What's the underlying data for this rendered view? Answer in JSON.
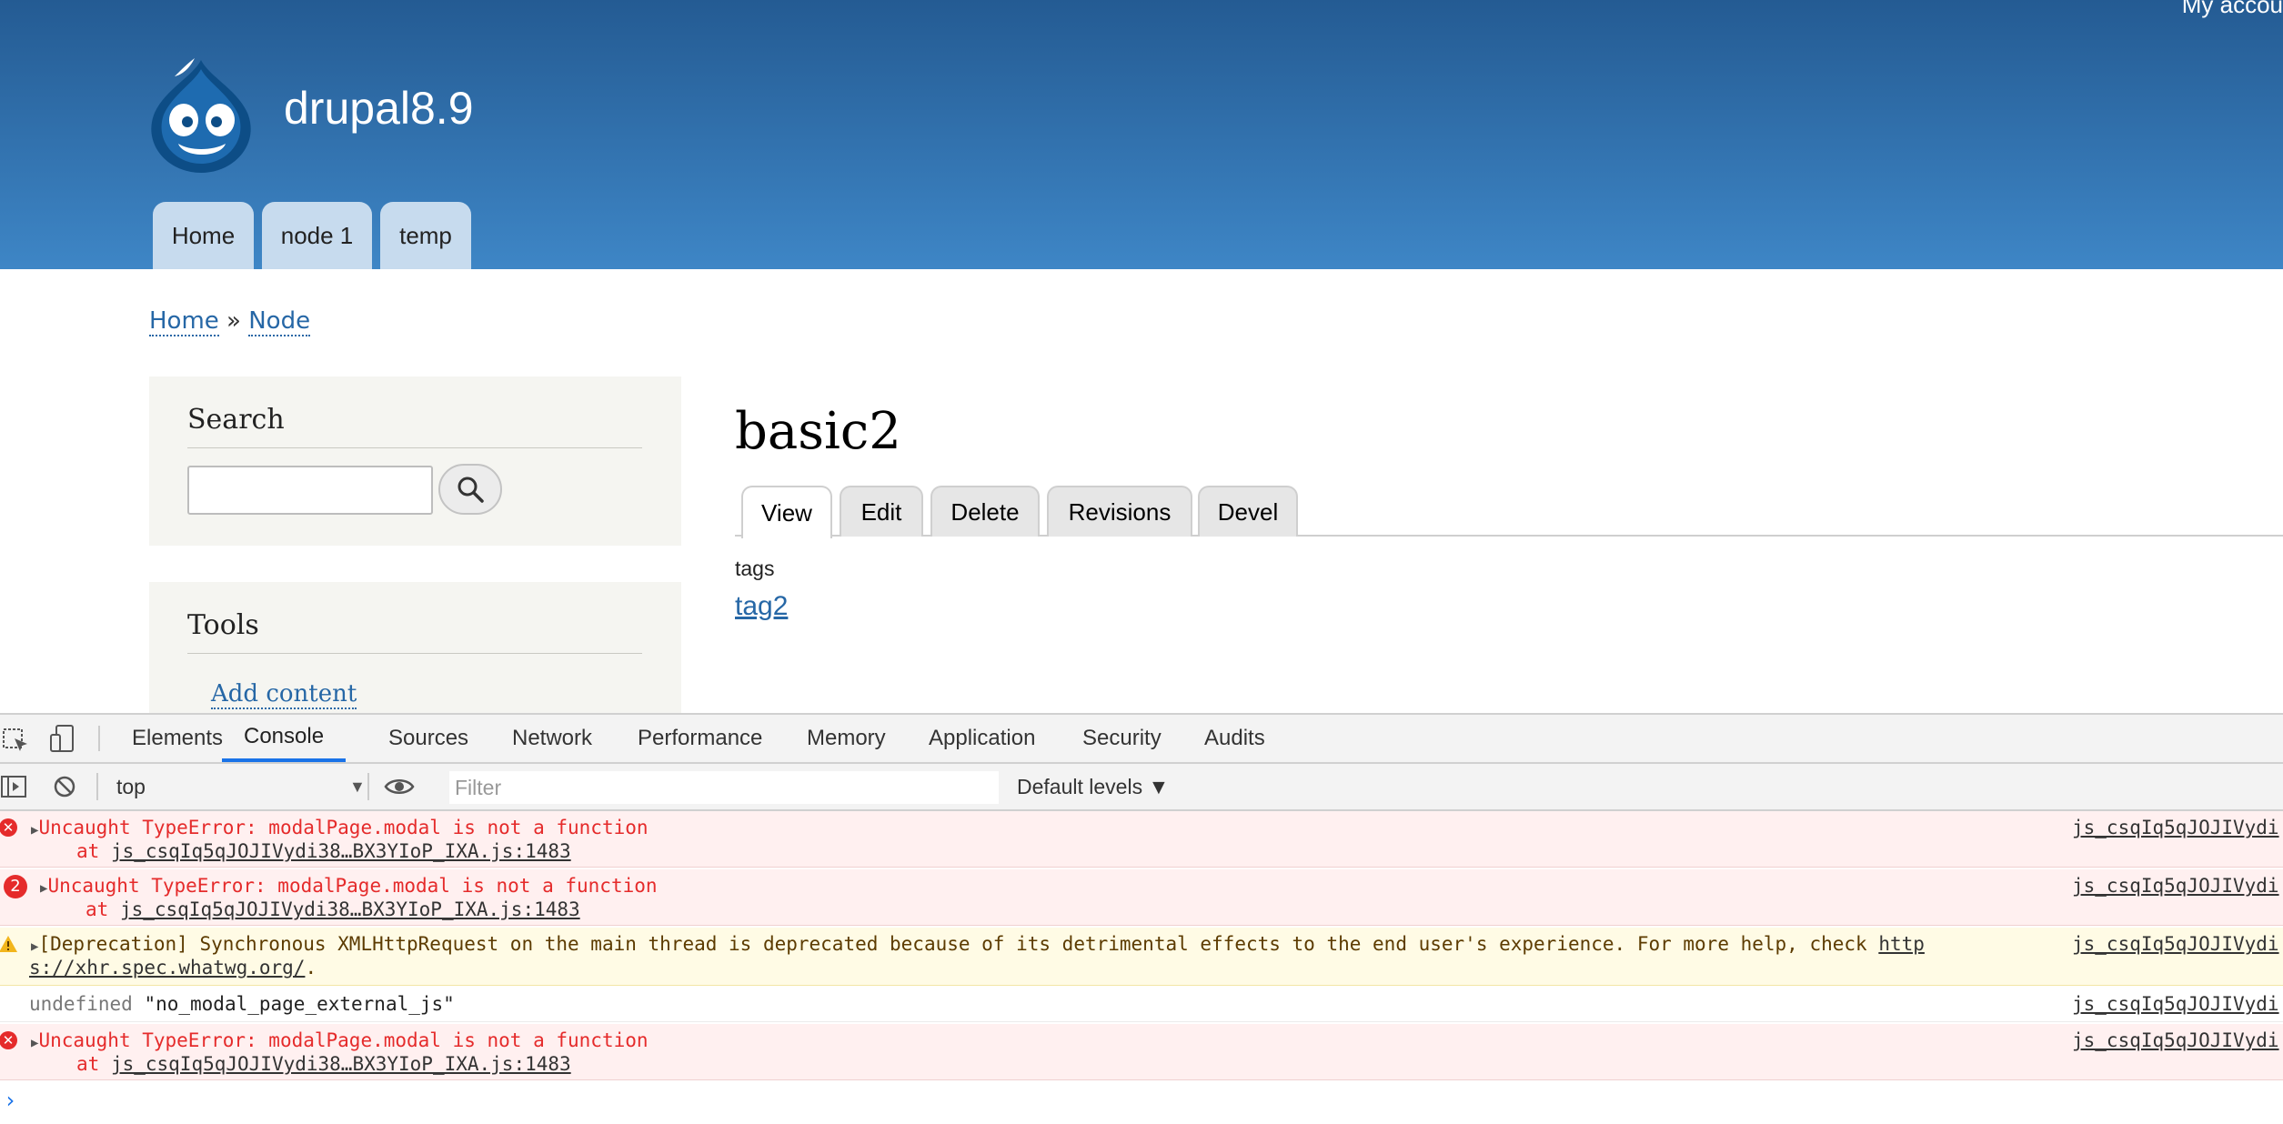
{
  "header": {
    "account_link": "My accou",
    "site_name": "drupal8.9",
    "nav": [
      "Home",
      "node 1",
      "temp"
    ]
  },
  "breadcrumb": {
    "home": "Home",
    "separator": "»",
    "node": "Node"
  },
  "sidebar": {
    "search_title": "Search",
    "search_placeholder": "",
    "tools_title": "Tools",
    "add_content": "Add content"
  },
  "main": {
    "title": "basic2",
    "tabs": [
      "View",
      "Edit",
      "Delete",
      "Revisions",
      "Devel"
    ],
    "active_tab": "View",
    "field_label": "tags",
    "tag": "tag2"
  },
  "devtools": {
    "tabs": [
      "Elements",
      "Console",
      "Sources",
      "Network",
      "Performance",
      "Memory",
      "Application",
      "Security",
      "Audits"
    ],
    "active_tab": "Console",
    "context": "top",
    "filter_placeholder": "Filter",
    "levels": "Default levels ▼",
    "messages": [
      {
        "level": "error",
        "count": "",
        "text": "Uncaught TypeError: modalPage.modal is not a function",
        "at_prefix": "at ",
        "at_link": "js_csqIq5qJOJIVydi38…BX3YIoP_IXA.js:1483",
        "source": "js_csqIq5qJOJIVydi"
      },
      {
        "level": "error",
        "count": "2",
        "text": "Uncaught TypeError: modalPage.modal is not a function",
        "at_prefix": "at ",
        "at_link": "js_csqIq5qJOJIVydi38…BX3YIoP_IXA.js:1483",
        "source": "js_csqIq5qJOJIVydi"
      },
      {
        "level": "warning",
        "text": "[Deprecation] Synchronous XMLHttpRequest on the main thread is deprecated because of its detrimental effects to the end user's experience. For more help, check ",
        "link_a": "http",
        "link_b": "s://xhr.spec.whatwg.org/",
        "tail": ".",
        "source": "js_csqIq5qJOJIVydi"
      },
      {
        "level": "log",
        "text_a": "undefined ",
        "text_b": "\"no_modal_page_external_js\"",
        "source": "js_csqIq5qJOJIVydi"
      },
      {
        "level": "error",
        "count": "",
        "text": "Uncaught TypeError: modalPage.modal is not a function",
        "at_prefix": "at ",
        "at_link": "js_csqIq5qJOJIVydi38…BX3YIoP_IXA.js:1483",
        "source": "js_csqIq5qJOJIVydi"
      }
    ],
    "prompt": "›"
  },
  "colors": {
    "header_top": "#245b93",
    "header_bottom": "#3e86c6",
    "link": "#2667a6",
    "error": "#e52b2b",
    "accent": "#1a73e8"
  }
}
